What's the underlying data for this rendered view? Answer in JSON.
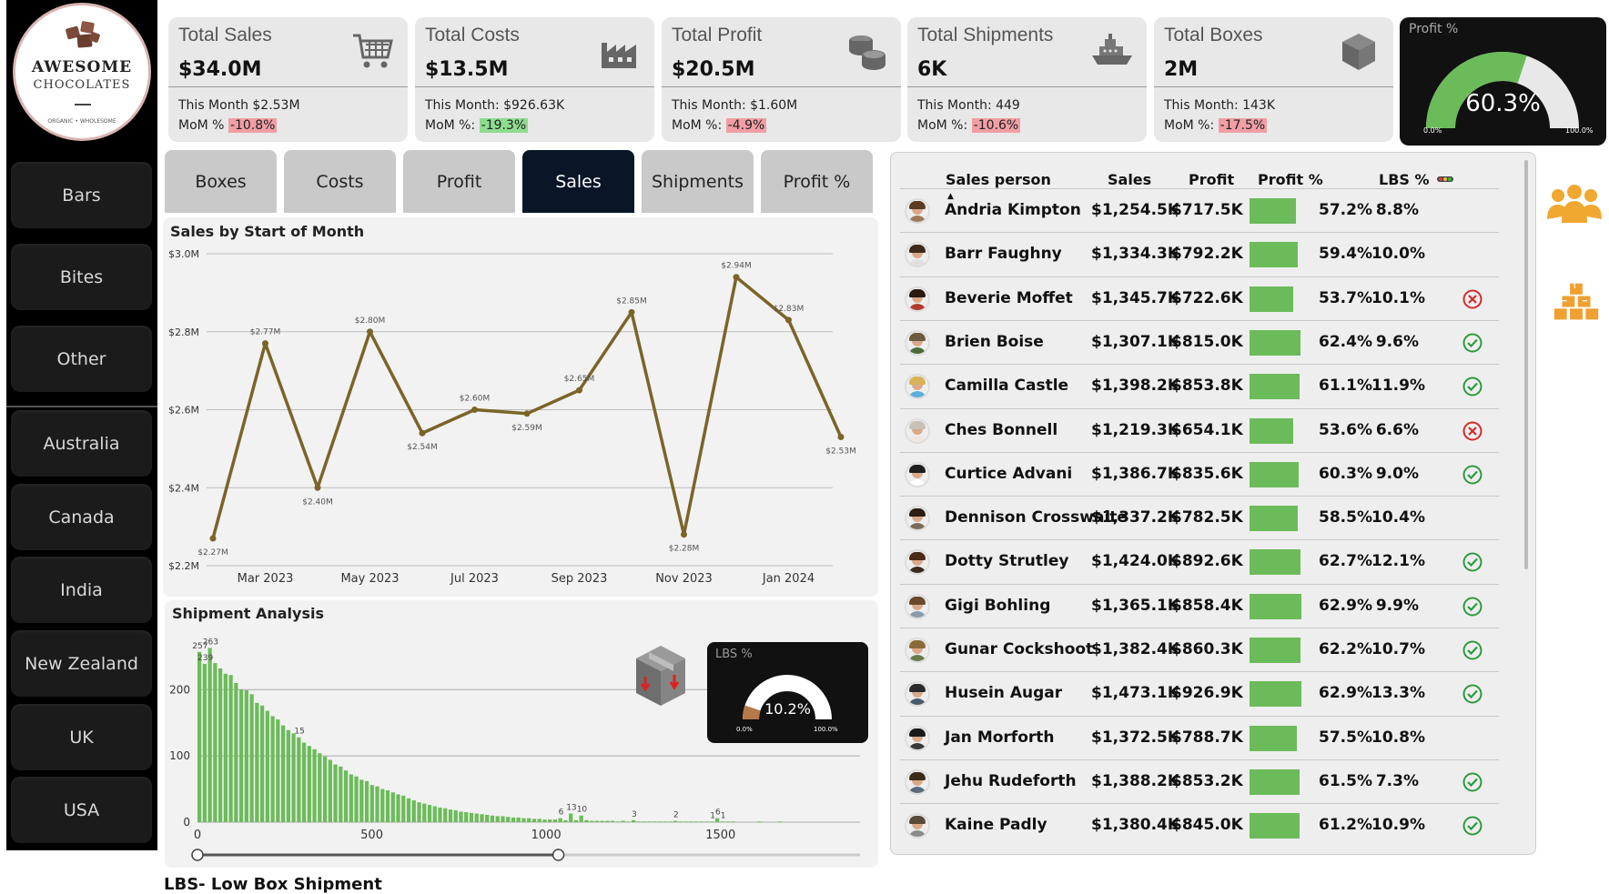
{
  "brand": {
    "line1": "AWESOME",
    "line2": "CHOCOLATES",
    "tagline": "ORGANIC • WHOLESOME"
  },
  "sidebar": {
    "items": [
      {
        "label": "Bars"
      },
      {
        "label": "Bites"
      },
      {
        "label": "Other"
      },
      {
        "label": "Australia"
      },
      {
        "label": "Canada"
      },
      {
        "label": "India"
      },
      {
        "label": "New Zealand"
      },
      {
        "label": "UK"
      },
      {
        "label": "USA"
      }
    ]
  },
  "kpis": [
    {
      "title": "Total Sales",
      "value": "$34.0M",
      "month": "This Month $2.53M",
      "mom_label": "MoM % ",
      "mom_value": "-10.8%",
      "mom_status": "neg",
      "icon": "cart-icon"
    },
    {
      "title": "Total Costs",
      "value": "$13.5M",
      "month": "This Month: $926.63K",
      "mom_label": "MoM %: ",
      "mom_value": "-19.3%",
      "mom_status": "pos",
      "icon": "factory-icon"
    },
    {
      "title": "Total Profit",
      "value": "$20.5M",
      "month": "This Month: $1.60M",
      "mom_label": "MoM %: ",
      "mom_value": "-4.9%",
      "mom_status": "neg",
      "icon": "coins-icon"
    },
    {
      "title": "Total Shipments",
      "value": "6K",
      "month": "This Month: 449",
      "mom_label": "MoM %: ",
      "mom_value": "-10.6%",
      "mom_status": "neg",
      "icon": "ship-icon"
    },
    {
      "title": "Total Boxes",
      "value": "2M",
      "month": "This Month: 143K",
      "mom_label": "MoM %: ",
      "mom_value": "-17.5%",
      "mom_status": "neg",
      "icon": "box-icon"
    }
  ],
  "profit_gauge": {
    "title": "Profit %",
    "value": "60.3%",
    "fraction": 0.603,
    "min": "0.0%",
    "max": "100.0%",
    "color": "#6cbb5a"
  },
  "tabs": [
    {
      "label": "Boxes",
      "active": false
    },
    {
      "label": "Costs",
      "active": false
    },
    {
      "label": "Profit",
      "active": false
    },
    {
      "label": "Sales",
      "active": true
    },
    {
      "label": "Shipments",
      "active": false
    },
    {
      "label": "Profit %",
      "active": false
    }
  ],
  "colors": {
    "line": "#7a6428",
    "bars": "#6cbb5a",
    "negative": "#f19ea4",
    "positive": "#8fdc8f",
    "active_tab": "#0a1628",
    "lbs_fill": "#b57a4a"
  },
  "chart_data": [
    {
      "type": "line",
      "title": "Sales by Start of Month",
      "x": [
        "Feb 2023",
        "Mar 2023",
        "Apr 2023",
        "May 2023",
        "Jun 2023",
        "Jul 2023",
        "Aug 2023",
        "Sep 2023",
        "Oct 2023",
        "Nov 2023",
        "Dec 2023",
        "Jan 2024",
        "Feb 2024"
      ],
      "x_tick_labels": [
        "Mar 2023",
        "May 2023",
        "Jul 2023",
        "Sep 2023",
        "Nov 2023",
        "Jan 2024"
      ],
      "series": [
        {
          "values": [
            2.27,
            2.77,
            2.4,
            2.8,
            2.54,
            2.6,
            2.59,
            2.65,
            2.85,
            2.28,
            2.94,
            2.83,
            2.53
          ]
        }
      ],
      "data_labels": [
        "$2.27M",
        "$2.77M",
        "$2.40M",
        "$2.80M",
        "$2.54M",
        "$2.60M",
        "$2.59M",
        "$2.65M",
        "$2.85M",
        "$2.28M",
        "$2.94M",
        "$2.83M",
        "$2.53M"
      ],
      "y_ticks": [
        "$2.2M",
        "$2.4M",
        "$2.6M",
        "$2.8M",
        "$3.0M"
      ],
      "ylim": [
        2.2,
        3.0
      ],
      "grid": true
    },
    {
      "type": "bar",
      "title": "Shipment Analysis",
      "x_start": 0,
      "x_step": 15,
      "values": [
        257,
        239,
        263,
        240,
        232,
        224,
        222,
        210,
        200,
        199,
        193,
        180,
        176,
        168,
        160,
        155,
        146,
        139,
        134,
        128,
        120,
        115,
        110,
        104,
        99,
        94,
        87,
        84,
        78,
        72,
        69,
        64,
        62,
        56,
        54,
        50,
        48,
        45,
        42,
        40,
        36,
        33,
        30,
        28,
        26,
        24,
        22,
        21,
        19,
        18,
        16,
        15,
        14,
        13,
        12,
        11,
        10,
        9,
        9,
        8,
        7,
        7,
        6,
        6,
        5,
        5,
        4,
        4,
        4,
        6,
        3,
        13,
        3,
        10,
        3,
        2,
        2,
        2,
        2,
        2,
        1,
        2,
        1,
        3,
        1,
        1,
        1,
        1,
        1,
        1,
        1,
        2,
        1,
        1,
        1,
        1,
        1,
        1,
        1,
        6,
        1,
        1,
        1,
        0,
        0,
        0,
        0,
        1,
        0,
        0,
        0,
        1
      ],
      "data_labels": [
        {
          "index": 0,
          "text": "257"
        },
        {
          "index": 1,
          "text": "239"
        },
        {
          "index": 2,
          "text": "263"
        },
        {
          "index": 19,
          "text": "15"
        },
        {
          "index": 69,
          "text": "6"
        },
        {
          "index": 71,
          "text": "13"
        },
        {
          "index": 73,
          "text": "10"
        },
        {
          "index": 83,
          "text": "3"
        },
        {
          "index": 91,
          "text": "2"
        },
        {
          "index": 98,
          "text": "1"
        },
        {
          "index": 99,
          "text": "6"
        },
        {
          "index": 100,
          "text": "1"
        }
      ],
      "x_ticks": [
        "0",
        "500",
        "1000",
        "1500"
      ],
      "y_ticks": [
        "0",
        "100",
        "200"
      ],
      "ylim": [
        0,
        280
      ],
      "xlim": [
        0,
        1900
      ],
      "slider_range": [
        0,
        1035
      ]
    }
  ],
  "lbs_gauge": {
    "title": "LBS %",
    "value": "10.2%",
    "fraction": 0.102,
    "min": "0.0%",
    "max": "100.0%"
  },
  "lbs_note": "LBS- Low Box Shipment",
  "table": {
    "headers": {
      "name": "Sales person",
      "sales": "Sales",
      "profit": "Profit",
      "profit_pct": "Profit %",
      "lbs_pct": "LBS %"
    },
    "rows": [
      {
        "name": "Andria Kimpton",
        "sales": "$1,254.5K",
        "profit": "$717.5K",
        "profit_pct": "57.2%",
        "profit_frac": 0.572,
        "lbs": "8.8%",
        "status": "none",
        "hair": "#5a3b22",
        "shirt": "#a0785a"
      },
      {
        "name": "Barr Faughny",
        "sales": "$1,334.3K",
        "profit": "$792.2K",
        "profit_pct": "59.4%",
        "profit_frac": 0.594,
        "lbs": "10.0%",
        "status": "none",
        "hair": "#3c2a1c",
        "shirt": "#e0e0e0"
      },
      {
        "name": "Beverie Moffet",
        "sales": "$1,345.7K",
        "profit": "$722.6K",
        "profit_pct": "53.7%",
        "profit_frac": 0.537,
        "lbs": "10.1%",
        "status": "bad",
        "hair": "#2b1a10",
        "shirt": "#b23a2e"
      },
      {
        "name": "Brien Boise",
        "sales": "$1,307.1K",
        "profit": "$815.0K",
        "profit_pct": "62.4%",
        "profit_frac": 0.624,
        "lbs": "9.6%",
        "status": "good",
        "hair": "#6b5a3e",
        "shirt": "#4d6a3a"
      },
      {
        "name": "Camilla Castle",
        "sales": "$1,398.2K",
        "profit": "$853.8K",
        "profit_pct": "61.1%",
        "profit_frac": 0.611,
        "lbs": "11.9%",
        "status": "good",
        "hair": "#d8b25a",
        "shirt": "#5ab0d8"
      },
      {
        "name": "Ches Bonnell",
        "sales": "$1,219.3K",
        "profit": "$654.1K",
        "profit_pct": "53.6%",
        "profit_frac": 0.536,
        "lbs": "6.6%",
        "status": "bad",
        "hair": "#c9c0b8",
        "shirt": "#f0e8e0"
      },
      {
        "name": "Curtice Advani",
        "sales": "$1,386.7K",
        "profit": "$835.6K",
        "profit_pct": "60.3%",
        "profit_frac": 0.603,
        "lbs": "9.0%",
        "status": "good",
        "hair": "#1e1e1e",
        "shirt": "#ffffff"
      },
      {
        "name": "Dennison Crosswaite",
        "sales": "$1,337.2K",
        "profit": "$782.5K",
        "profit_pct": "58.5%",
        "profit_frac": 0.585,
        "lbs": "10.4%",
        "status": "none",
        "hair": "#2c1e14",
        "shirt": "#7a6a5a"
      },
      {
        "name": "Dotty Strutley",
        "sales": "$1,424.0K",
        "profit": "$892.6K",
        "profit_pct": "62.7%",
        "profit_frac": 0.627,
        "lbs": "12.1%",
        "status": "good",
        "hair": "#4a2a18",
        "shirt": "#3a2a22"
      },
      {
        "name": "Gigi Bohling",
        "sales": "$1,365.1K",
        "profit": "$858.4K",
        "profit_pct": "62.9%",
        "profit_frac": 0.629,
        "lbs": "9.9%",
        "status": "good",
        "hair": "#6a4a2a",
        "shirt": "#8a9aaa"
      },
      {
        "name": "Gunar Cockshoot",
        "sales": "$1,382.4K",
        "profit": "$860.3K",
        "profit_pct": "62.2%",
        "profit_frac": 0.622,
        "lbs": "10.7%",
        "status": "good",
        "hair": "#8a6a3a",
        "shirt": "#6a7a4a"
      },
      {
        "name": "Husein Augar",
        "sales": "$1,473.1K",
        "profit": "$926.9K",
        "profit_pct": "62.9%",
        "profit_frac": 0.629,
        "lbs": "13.3%",
        "status": "good",
        "hair": "#2a2a2a",
        "shirt": "#4a5a6a"
      },
      {
        "name": "Jan Morforth",
        "sales": "$1,372.5K",
        "profit": "$788.7K",
        "profit_pct": "57.5%",
        "profit_frac": 0.575,
        "lbs": "10.8%",
        "status": "none",
        "hair": "#1a1a1a",
        "shirt": "#3a3a3a"
      },
      {
        "name": "Jehu Rudeforth",
        "sales": "$1,388.2K",
        "profit": "$853.2K",
        "profit_pct": "61.5%",
        "profit_frac": 0.615,
        "lbs": "7.3%",
        "status": "good",
        "hair": "#3a2a1a",
        "shirt": "#5a6a7a"
      },
      {
        "name": "Kaine Padly",
        "sales": "$1,380.4K",
        "profit": "$845.0K",
        "profit_pct": "61.2%",
        "profit_frac": 0.612,
        "lbs": "10.9%",
        "status": "good",
        "hair": "#5a4a3a",
        "shirt": "#8a8a8a"
      }
    ]
  },
  "side_icons": [
    "people-icon",
    "boxes-stack-icon"
  ]
}
